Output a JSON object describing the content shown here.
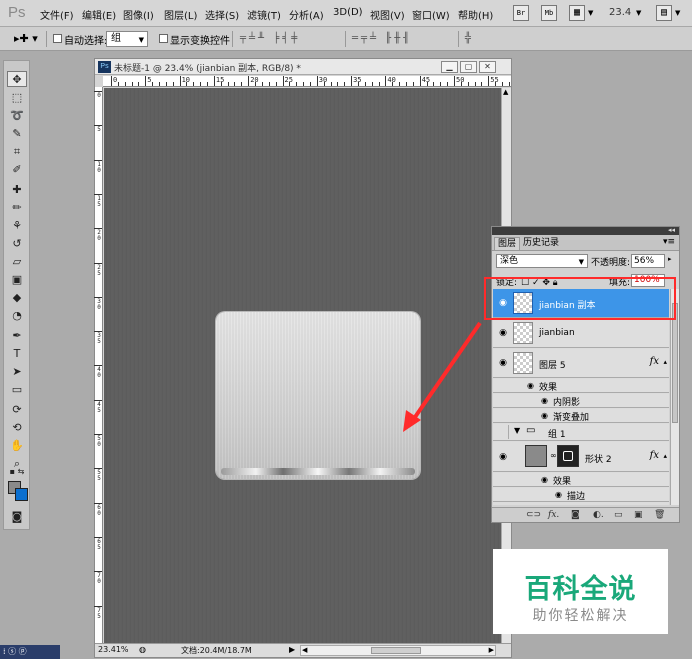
{
  "app": {
    "logo": "Ps"
  },
  "menu": {
    "items": [
      "文件(F)",
      "编辑(E)",
      "图像(I)",
      "图层(L)",
      "选择(S)",
      "滤镜(T)",
      "分析(A)",
      "3D(D)",
      "视图(V)",
      "窗口(W)",
      "帮助(H)"
    ],
    "bridge_label": "Br",
    "minibridge_label": "Mb",
    "zoom_value": "23.4"
  },
  "options": {
    "auto_select_label": "自动选择:",
    "auto_select_value": "组",
    "show_transform_label": "显示变换控件"
  },
  "document": {
    "title": "未标题-1 @ 23.4% (jianbian 副本, RGB/8) *",
    "ruler_h": [
      "0",
      "5",
      "10",
      "15",
      "20",
      "25",
      "30",
      "35",
      "40",
      "45",
      "50",
      "55"
    ],
    "ruler_v": [
      "0",
      "5",
      "10",
      "15",
      "20",
      "25",
      "30",
      "35",
      "40",
      "45",
      "50",
      "55",
      "60",
      "65",
      "70",
      "75",
      "80"
    ],
    "status_zoom": "23.41%",
    "status_doc": "文档:20.4M/18.7M"
  },
  "layers_panel": {
    "tabs": [
      "图层",
      "历史记录"
    ],
    "blend_mode": "深色",
    "opacity_label": "不透明度:",
    "opacity_value": "56%",
    "lock_label": "锁定:",
    "fill_label": "填充:",
    "fill_value": "100%",
    "layers": [
      {
        "name": "jianbian 副本",
        "selected": true
      },
      {
        "name": "jianbian",
        "selected": false
      },
      {
        "name": "图层 5",
        "selected": false,
        "fx": "fx"
      },
      {
        "name": "效果",
        "kind": "effects"
      },
      {
        "name": "内阴影",
        "kind": "effect"
      },
      {
        "name": "渐变叠加",
        "kind": "effect"
      },
      {
        "name": "组 1",
        "kind": "group"
      },
      {
        "name": "形状 2",
        "selected": false,
        "fx": "fx"
      },
      {
        "name": "效果",
        "kind": "effects"
      },
      {
        "name": "描边",
        "kind": "effect"
      }
    ],
    "bottom_fx": "fx."
  },
  "watermark": {
    "title": "百科全说",
    "subtitle": "助你轻松解决"
  },
  "colors": {
    "selection_blue": "#3d95e8",
    "callout_red": "#ff2a2a",
    "watermark_green": "#1aa87a"
  }
}
